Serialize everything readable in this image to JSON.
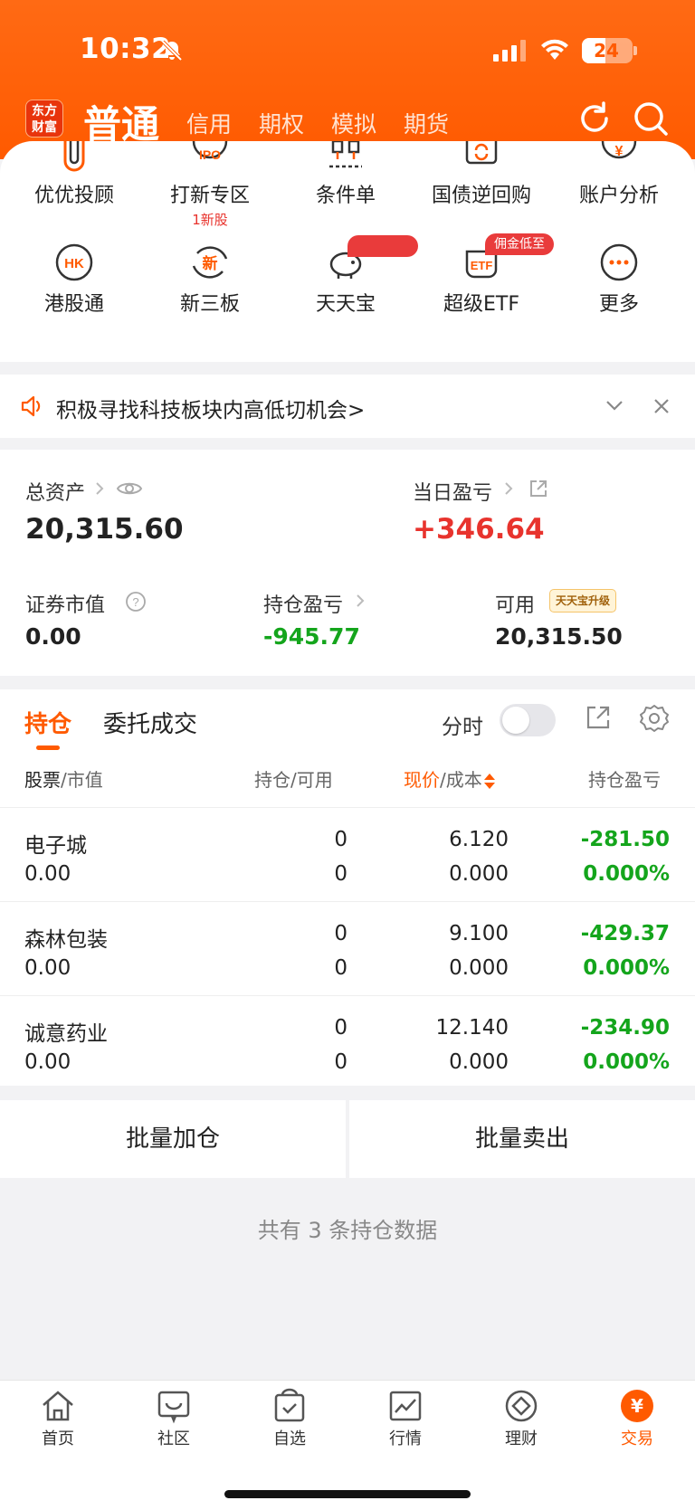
{
  "status_bar": {
    "time": "10:32",
    "battery": "24"
  },
  "header": {
    "logo_line1": "东方",
    "logo_line2": "财富",
    "title": "普通",
    "tabs": [
      "信用",
      "期权",
      "模拟",
      "期货"
    ]
  },
  "quick_grid": {
    "row1": [
      {
        "label": "优优投顾",
        "icon": "clip-icon"
      },
      {
        "label": "打新专区",
        "icon": "ipo-icon",
        "sub": "1新股"
      },
      {
        "label": "条件单",
        "icon": "condition-icon"
      },
      {
        "label": "国债逆回购",
        "icon": "repo-icon"
      },
      {
        "label": "账户分析",
        "icon": "account-analysis-icon"
      }
    ],
    "row2": [
      {
        "label": "港股通",
        "icon": "hk-icon"
      },
      {
        "label": "新三板",
        "icon": "new-board-icon"
      },
      {
        "label": "天天宝",
        "icon": "piggy-bank-icon"
      },
      {
        "label": "超级ETF",
        "icon": "etf-icon",
        "badge": "佣金低至"
      },
      {
        "label": "更多",
        "icon": "more-icon"
      }
    ]
  },
  "notice": {
    "text": "积极寻找科技板块内高低切机会>"
  },
  "assets": {
    "total_label": "总资产",
    "total_value": "20,315.60",
    "daily_pl_label": "当日盈亏",
    "daily_pl_value": "+346.64",
    "market_value_label": "证券市值",
    "market_value": "0.00",
    "position_pl_label": "持仓盈亏",
    "position_pl_value": "-945.77",
    "available_label": "可用",
    "available_badge": "天天宝升级",
    "available_value": "20,315.50"
  },
  "holdings": {
    "tab_active": "持仓",
    "tab_other": "委托成交",
    "fenshi_label": "分时",
    "headers": {
      "stock": "股票",
      "market_value": "市值",
      "position": "持仓",
      "available": "可用",
      "price": "现价",
      "cost": "成本",
      "pl": "持仓盈亏"
    },
    "rows": [
      {
        "name": "电子城",
        "mv": "0.00",
        "qty": "0",
        "avail": "0",
        "price": "6.120",
        "cost": "0.000",
        "pl": "-281.50",
        "pct": "0.000%"
      },
      {
        "name": "森林包装",
        "mv": "0.00",
        "qty": "0",
        "avail": "0",
        "price": "9.100",
        "cost": "0.000",
        "pl": "-429.37",
        "pct": "0.000%"
      },
      {
        "name": "诚意药业",
        "mv": "0.00",
        "qty": "0",
        "avail": "0",
        "price": "12.140",
        "cost": "0.000",
        "pl": "-234.90",
        "pct": "0.000%"
      }
    ]
  },
  "actions": {
    "batch_add": "批量加仓",
    "batch_sell": "批量卖出"
  },
  "footer_count": "共有 3 条持仓数据",
  "tabbar": [
    {
      "label": "首页",
      "icon": "home-icon"
    },
    {
      "label": "社区",
      "icon": "community-icon"
    },
    {
      "label": "自选",
      "icon": "watchlist-icon"
    },
    {
      "label": "行情",
      "icon": "market-icon"
    },
    {
      "label": "理财",
      "icon": "wealth-icon"
    },
    {
      "label": "交易",
      "icon": "trade-icon",
      "active": true
    }
  ],
  "colors": {
    "brand": "#ff5a00",
    "up": "#e8332d",
    "down": "#14a51c"
  }
}
